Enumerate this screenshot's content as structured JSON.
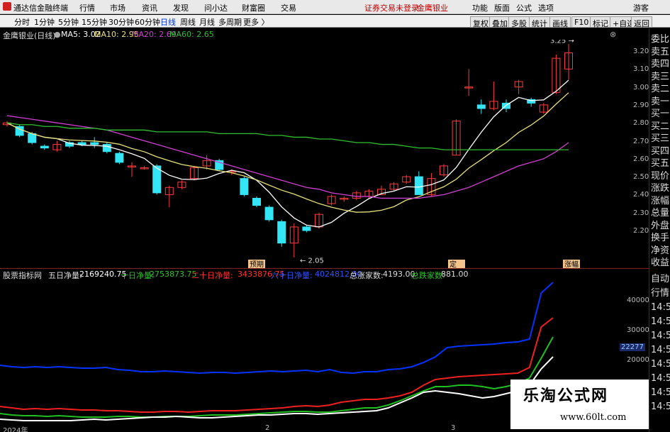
{
  "menubar": {
    "app_title": "通达信金融终端",
    "menus": [
      "行情",
      "市场",
      "资讯",
      "发现",
      "问小达",
      "财富圈",
      "交易"
    ],
    "alert_left": "证券交易未登录",
    "alert_right": "金鹰银业",
    "right_menus": [
      "功能",
      "版面",
      "公式",
      "选项"
    ],
    "guest": "游客"
  },
  "toolbar": {
    "periods": [
      "分时",
      "1分钟",
      "5分钟",
      "15分钟",
      "30分钟",
      "60分钟",
      "日线",
      "周线",
      "月线",
      "多周期",
      "更多 〉"
    ],
    "selected": "日线",
    "right_buttons": [
      "复权",
      "叠加",
      "多股",
      "统计",
      "画线",
      "F10",
      "标记",
      "+自选",
      "返回"
    ]
  },
  "main_chart": {
    "stock": "金鹰银业(日线)",
    "ma5": "MA5: 3.02",
    "ma10": "MA10: 2.95",
    "ma20": "MA20: 2.69",
    "ma60": "MA60: 2.65",
    "high_label": "3.25",
    "low_label": "2.05",
    "tags": [
      "预期",
      "定",
      "涨幅"
    ],
    "y_ticks": [
      "3.20",
      "3.10",
      "3.00",
      "2.90",
      "2.80",
      "2.70",
      "2.60",
      "2.50",
      "2.40",
      "2.30",
      "2.20"
    ]
  },
  "indicator": {
    "name": "股票指标网",
    "five_label": "五日净量:",
    "five_value": "2169240.75",
    "ten_label": "十日净量:",
    "ten_value": "2753873.75",
    "twenty_label": "二十日净量:",
    "twenty_value": "3433876.75",
    "sixty_label": "六十日净量:",
    "sixty_value": "4024812.00",
    "up_label": "总涨家数:",
    "up_value": "4193.00",
    "down_label": "总跌家数:",
    "down_value": "881.00",
    "y_ticks": [
      "40000",
      "30000",
      "20000"
    ],
    "current": "22277"
  },
  "x_labels": [
    "2024年",
    "2",
    "3"
  ],
  "sidebar": [
    "委比",
    "卖五",
    "卖四",
    "卖三",
    "卖二",
    "卖一",
    "买一",
    "买二",
    "买三",
    "买四",
    "买五",
    "现价",
    "涨跌",
    "涨幅",
    "总量",
    "外盘",
    "换手",
    "净资",
    "收益"
  ],
  "sidebar_bottom": [
    "自动",
    "行情",
    "14:5",
    "14:5",
    "14:5",
    "14:5",
    "14:5",
    "14:5",
    "14:5",
    "14:5"
  ],
  "watermark": {
    "title": "乐淘公式网",
    "url": "www.60lt.com"
  },
  "colors": {
    "up": "#ff3b3b",
    "down": "#33e5f5",
    "ma5": "#ffffff",
    "ma10": "#e8e07a",
    "ma20": "#d040d0",
    "ma60": "#30c030"
  }
}
